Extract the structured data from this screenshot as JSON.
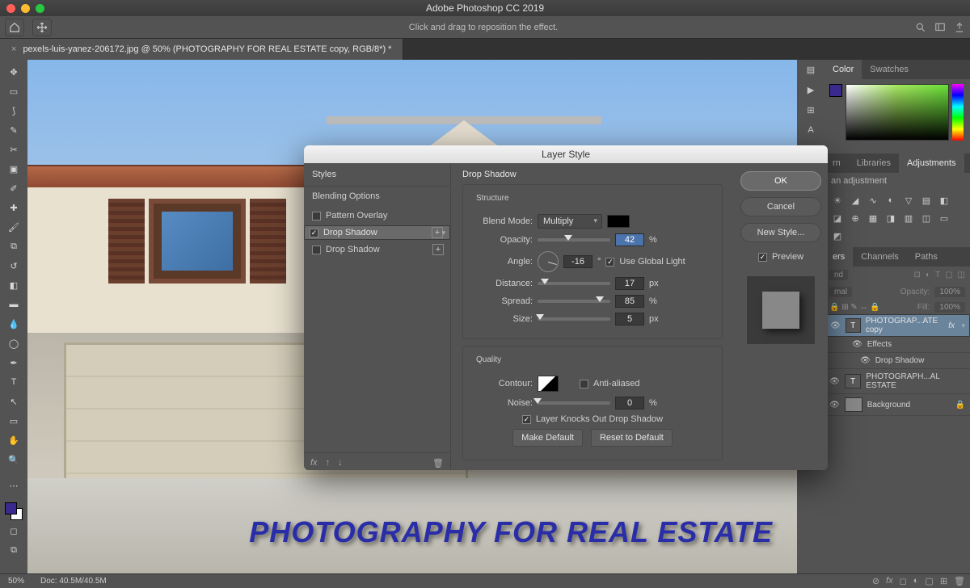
{
  "app": {
    "title": "Adobe Photoshop CC 2019"
  },
  "optionsbar": {
    "hint": "Click and drag to reposition the effect."
  },
  "document": {
    "tab": "pexels-luis-yanez-206172.jpg @ 50% (PHOTOGRAPHY FOR REAL ESTATE copy, RGB/8*) *"
  },
  "canvas": {
    "text": "PHOTOGRAPHY FOR REAL ESTATE"
  },
  "status": {
    "zoom": "50%",
    "doc": "Doc: 40.5M/40.5M"
  },
  "panels": {
    "color": {
      "tab1": "Color",
      "tab2": "Swatches"
    },
    "libs": {
      "tab2": "Libraries",
      "tab3": "Adjustments",
      "hint": "an adjustment"
    },
    "layers": {
      "tab1": "ers",
      "tab2": "Channels",
      "tab3": "Paths",
      "kind": "nd",
      "opacityLabel": "Opacity:",
      "opacity": "100%",
      "fillLabel": "Fill:",
      "fill": "100%",
      "layer1": "PHOTOGRAP...ATE copy",
      "fx": "fx",
      "effects": "Effects",
      "ds": "Drop Shadow",
      "layer2": "PHOTOGRAPH...AL ESTATE",
      "layer3": "Background"
    }
  },
  "dialog": {
    "title": "Layer Style",
    "left": {
      "styles": "Styles",
      "blending": "Blending Options",
      "pattern": "Pattern Overlay",
      "ds1": "Drop Shadow",
      "ds2": "Drop Shadow"
    },
    "mid": {
      "heading": "Drop Shadow",
      "structure": "Structure",
      "blendModeLabel": "Blend Mode:",
      "blendMode": "Multiply",
      "opacityLabel": "Opacity:",
      "opacity": "42",
      "angleLabel": "Angle:",
      "angle": "-16",
      "globalLight": "Use Global Light",
      "distanceLabel": "Distance:",
      "distance": "17",
      "spreadLabel": "Spread:",
      "spread": "85",
      "sizeLabel": "Size:",
      "size": "5",
      "px": "px",
      "pct": "%",
      "deg": "°",
      "quality": "Quality",
      "contourLabel": "Contour:",
      "antialias": "Anti-aliased",
      "noiseLabel": "Noise:",
      "noise": "0",
      "knockout": "Layer Knocks Out Drop Shadow",
      "makeDefault": "Make Default",
      "resetDefault": "Reset to Default"
    },
    "right": {
      "ok": "OK",
      "cancel": "Cancel",
      "newStyle": "New Style...",
      "preview": "Preview"
    }
  }
}
